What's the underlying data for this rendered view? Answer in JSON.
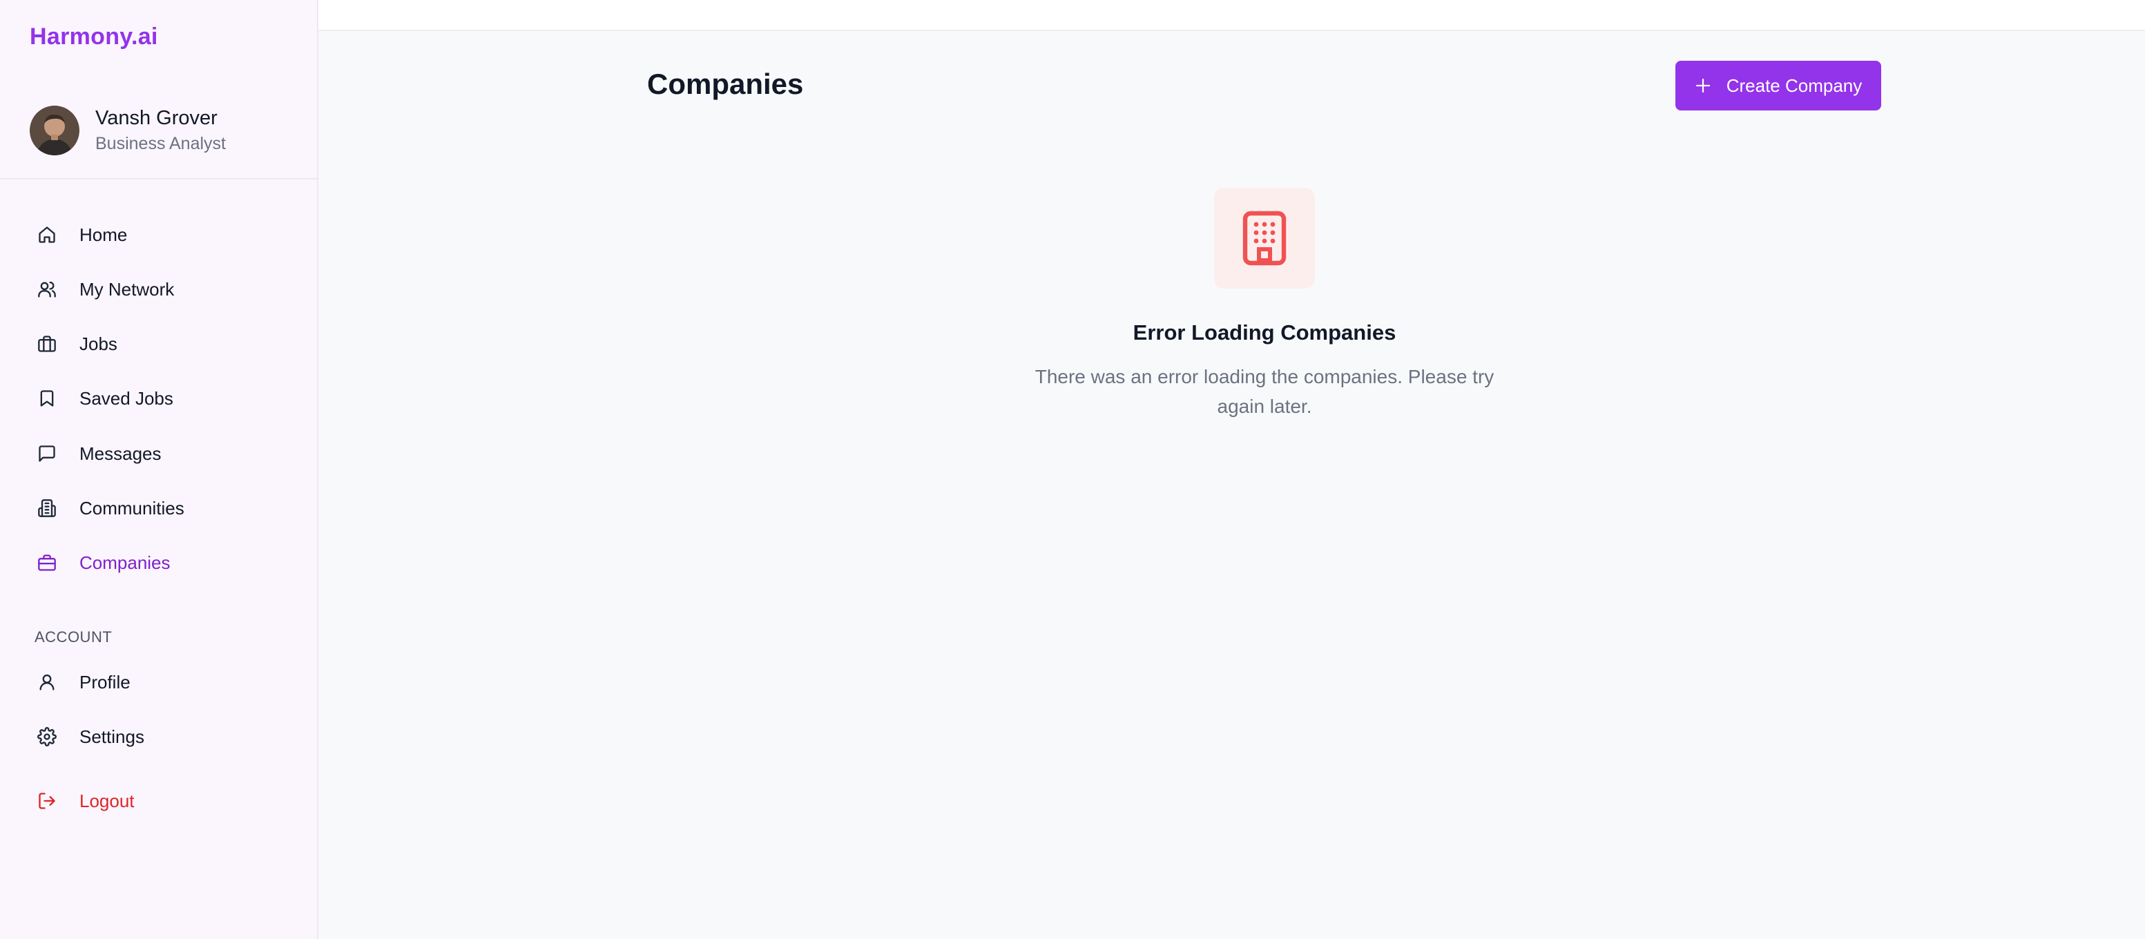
{
  "brand": {
    "name": "Harmony.ai"
  },
  "user": {
    "name": "Vansh Grover",
    "role": "Business Analyst"
  },
  "nav": {
    "items": [
      {
        "label": "Home",
        "icon": "home-icon"
      },
      {
        "label": "My Network",
        "icon": "users-icon"
      },
      {
        "label": "Jobs",
        "icon": "briefcase-icon"
      },
      {
        "label": "Saved Jobs",
        "icon": "bookmark-icon"
      },
      {
        "label": "Messages",
        "icon": "message-square-icon"
      },
      {
        "label": "Communities",
        "icon": "buildings-icon"
      },
      {
        "label": "Companies",
        "icon": "briefcase-active-icon",
        "active": true
      }
    ],
    "account_label": "ACCOUNT",
    "account_items": [
      {
        "label": "Profile",
        "icon": "user-icon"
      },
      {
        "label": "Settings",
        "icon": "gear-icon"
      }
    ],
    "logout_label": "Logout"
  },
  "main": {
    "title": "Companies",
    "create_button_label": "Create Company",
    "error": {
      "title": "Error Loading Companies",
      "message": "There was an error loading the companies. Please try again later."
    }
  },
  "colors": {
    "accent": "#9333ea",
    "active_nav": "#7e22ce",
    "danger": "#dc2626",
    "error_icon": "#f05252",
    "error_icon_bg": "#fdeeee"
  }
}
